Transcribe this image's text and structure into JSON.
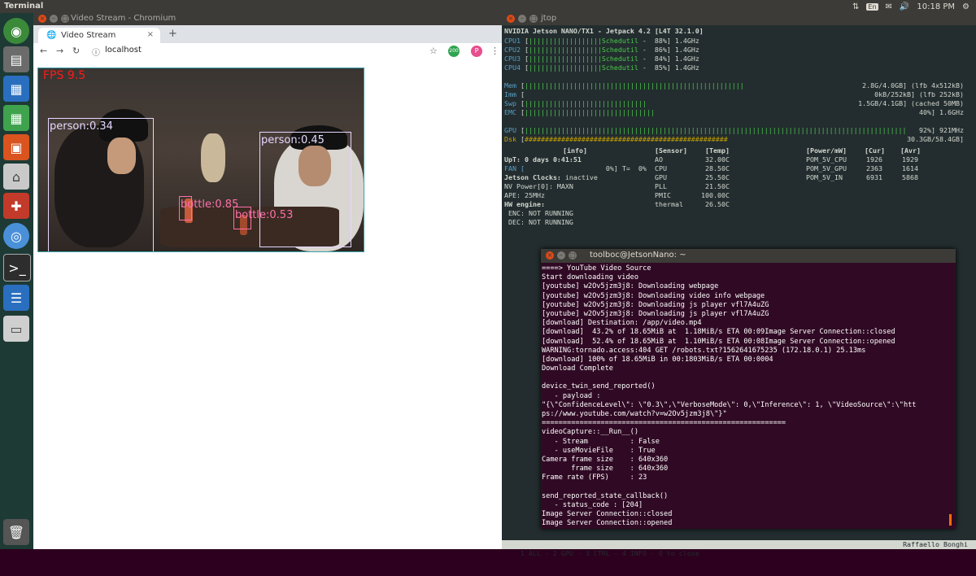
{
  "topbar": {
    "title": "Terminal",
    "lang": "En",
    "time": "10:18 PM"
  },
  "chromium": {
    "window_title": "Video Stream - Chromium",
    "tab_title": "Video Stream",
    "new_tab": "+",
    "close_tab": "×",
    "url": "localhost",
    "ext_badge": "200",
    "profile_letter": "P",
    "video": {
      "fps_label": "FPS 9.5",
      "detections": [
        {
          "label": "person:0.34"
        },
        {
          "label": "person:0.45"
        },
        {
          "label": "bottle:0.85"
        },
        {
          "label": "bottle:0.53"
        }
      ]
    }
  },
  "jtop": {
    "window_title": "jtop",
    "header": "NVIDIA Jetson NANO/TX1 - Jetpack 4.2 [L4T 32.1.0]",
    "cpus": [
      {
        "name": "CPU1",
        "gov": "Schedutil",
        "pct": "88%",
        "freq": "1.4GHz"
      },
      {
        "name": "CPU2",
        "gov": "Schedutil",
        "pct": "86%",
        "freq": "1.4GHz"
      },
      {
        "name": "CPU3",
        "gov": "Schedutil",
        "pct": "84%",
        "freq": "1.4GHz"
      },
      {
        "name": "CPU4",
        "gov": "Schedutil",
        "pct": "85%",
        "freq": "1.4GHz"
      }
    ],
    "mem": {
      "name": "Mem",
      "value": "2.8G/4.0GB] (lfb 4x512kB)"
    },
    "imm": {
      "name": "Imm",
      "value": "0kB/252kB] (lfb 252kB)"
    },
    "swp": {
      "name": "Swp",
      "value": "1.5GB/4.1GB] (cached 50MB)"
    },
    "emc": {
      "name": "EMC",
      "value": "40%] 1.6GHz"
    },
    "gpu": {
      "name": "GPU",
      "value": "92%] 921MHz"
    },
    "dsk": {
      "name": "Dsk",
      "value": "30.3GB/58.4GB]"
    },
    "info_header": "[info]",
    "uptime": "UpT: 0 days 0:41:51",
    "fan": "FAN [",
    "fan_val": "0%] T=  0%",
    "clocks": "Jetson Clocks: inactive",
    "nvpower": "NV Power[0]: MAXN",
    "ape": "APE: 25MHz",
    "hw": "HW engine:",
    "enc": " ENC: NOT RUNNING",
    "dec": " DEC: NOT RUNNING",
    "sensor_header": "[Sensor]",
    "temp_header": "[Temp]",
    "sensors": [
      {
        "name": "AO",
        "temp": "32.00C"
      },
      {
        "name": "CPU",
        "temp": "28.50C"
      },
      {
        "name": "GPU",
        "temp": "25.50C"
      },
      {
        "name": "PLL",
        "temp": "21.50C"
      },
      {
        "name": "PMIC",
        "temp": "100.00C"
      },
      {
        "name": "thermal",
        "temp": "26.50C"
      }
    ],
    "power_header": "[Power/mW]",
    "cur_header": "[Cur]",
    "avr_header": "[Avr]",
    "power": [
      {
        "name": "POM_5V_CPU",
        "cur": "1926",
        "avr": "1929"
      },
      {
        "name": "POM_5V_GPU",
        "cur": "2363",
        "avr": "1614"
      },
      {
        "name": "POM_5V_IN",
        "cur": "6931",
        "avr": "5868"
      }
    ],
    "statusbar": "1 ALL - 2 GPU - 3 CTRL - 4 INFO - Q to close",
    "author": "Raffaello Bonghi"
  },
  "terminal": {
    "window_title": "toolboc@JetsonNano: ~",
    "lines": [
      "====> YouTube Video Source",
      "Start downloading video",
      "[youtube] w2Ov5jzm3j8: Downloading webpage",
      "[youtube] w2Ov5jzm3j8: Downloading video info webpage",
      "[youtube] w2Ov5jzm3j8: Downloading js player vfl7A4uZG",
      "[youtube] w2Ov5jzm3j8: Downloading js player vfl7A4uZG",
      "[download] Destination: /app/video.mp4",
      "[download]  43.2% of 18.65MiB at  1.18MiB/s ETA 00:09Image Server Connection::closed",
      "[download]  52.4% of 18.65MiB at  1.10MiB/s ETA 00:08Image Server Connection::opened",
      "WARNING:tornado.access:404 GET /robots.txt?1562641675235 (172.18.0.1) 25.13ms",
      "[download] 100% of 18.65MiB in 00:1803MiB/s ETA 00:0004",
      "Download Complete",
      "",
      "device_twin_send_reported()",
      "   - payload :",
      "\"{\\\"ConfidenceLevel\\\": \\\"0.3\\\",\\\"VerboseMode\\\": 0,\\\"Inference\\\": 1, \\\"VideoSource\\\":\\\"htt",
      "ps://www.youtube.com/watch?v=w2Ov5jzm3j8\\\"}\"",
      "==========================================================",
      "videoCapture::__Run__()",
      "   - Stream          : False",
      "   - useMovieFile    : True",
      "Camera frame size    : 640x360",
      "       frame size    : 640x360",
      "Frame rate (FPS)     : 23",
      "",
      "send_reported_state_callback()",
      "   - status_code : [204]",
      "Image Server Connection::closed",
      "Image Server Connection::opened"
    ]
  },
  "colors": {
    "launcher": "#1e3a35",
    "terminal_bg": "#300a24",
    "jtop_bg": "#232d2f",
    "fps": "#ff1a1a",
    "person_box": "#e6d7ff",
    "bottle_box": "#ff6fa8"
  }
}
